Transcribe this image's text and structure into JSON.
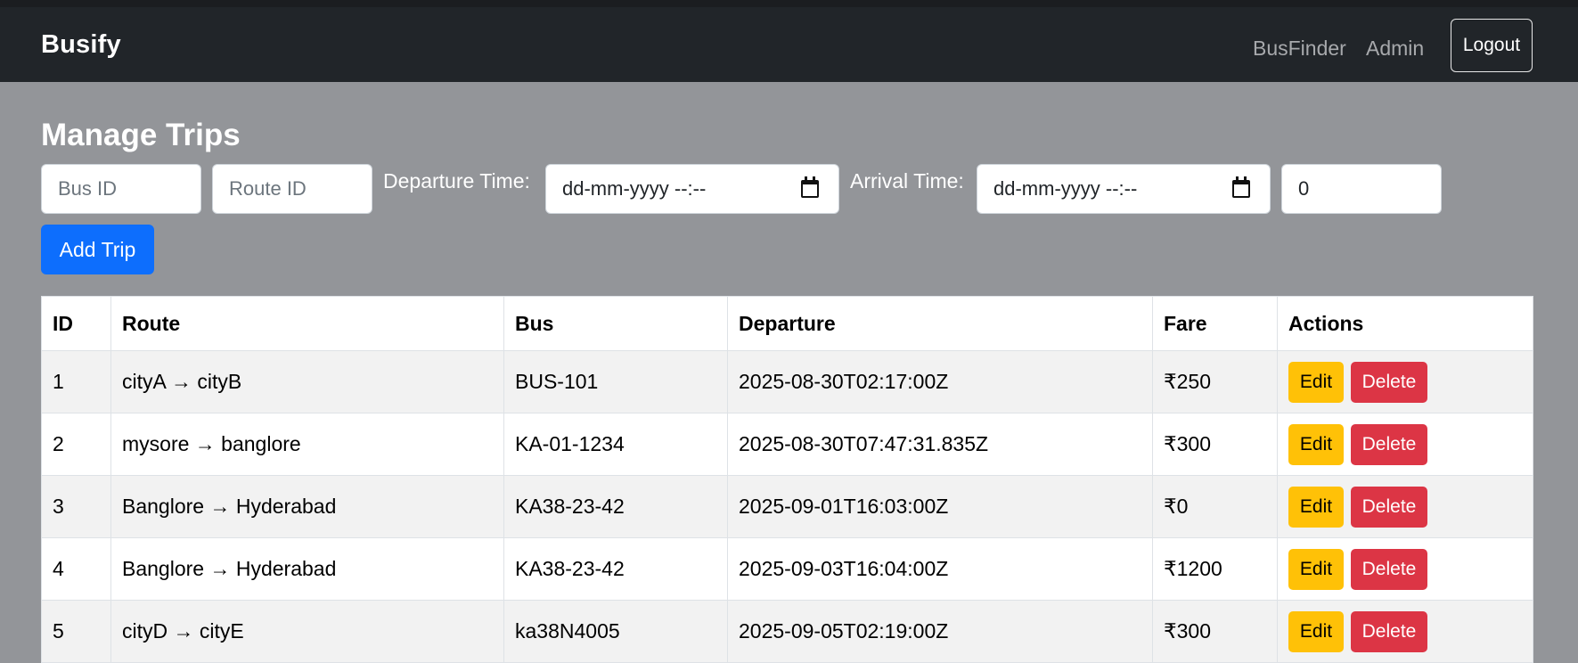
{
  "navbar": {
    "brand": "Busify",
    "links": [
      "BusFinder",
      "Admin"
    ],
    "logout_label": "Logout"
  },
  "page": {
    "title": "Manage Trips"
  },
  "form": {
    "bus_id_placeholder": "Bus ID",
    "route_id_placeholder": "Route ID",
    "departure_label": "Departure Time:",
    "departure_value": "dd-mm-yyyy --:--",
    "arrival_label": "Arrival Time:",
    "arrival_value": "dd-mm-yyyy --:--",
    "fare_value": "0",
    "add_button_label": "Add Trip"
  },
  "table": {
    "headers": [
      "ID",
      "Route",
      "Bus",
      "Departure",
      "Fare",
      "Actions"
    ],
    "rows": [
      {
        "id": "1",
        "route": "cityA → cityB",
        "bus": "BUS-101",
        "departure": "2025-08-30T02:17:00Z",
        "fare": "₹250"
      },
      {
        "id": "2",
        "route": "mysore → banglore",
        "bus": "KA-01-1234",
        "departure": "2025-08-30T07:47:31.835Z",
        "fare": "₹300"
      },
      {
        "id": "3",
        "route": "Banglore → Hyderabad",
        "bus": "KA38-23-42",
        "departure": "2025-09-01T16:03:00Z",
        "fare": "₹0"
      },
      {
        "id": "4",
        "route": "Banglore → Hyderabad",
        "bus": "KA38-23-42",
        "departure": "2025-09-03T16:04:00Z",
        "fare": "₹1200"
      },
      {
        "id": "5",
        "route": "cityD → cityE",
        "bus": "ka38N4005",
        "departure": "2025-09-05T02:19:00Z",
        "fare": "₹300"
      }
    ],
    "edit_label": "Edit",
    "delete_label": "Delete"
  },
  "colors": {
    "navbar_bg": "#212529",
    "page_bg": "#939599",
    "primary": "#0d6efd",
    "warning": "#ffc107",
    "danger": "#dc3545"
  },
  "icons": {
    "date_picker": "calendar-icon"
  }
}
